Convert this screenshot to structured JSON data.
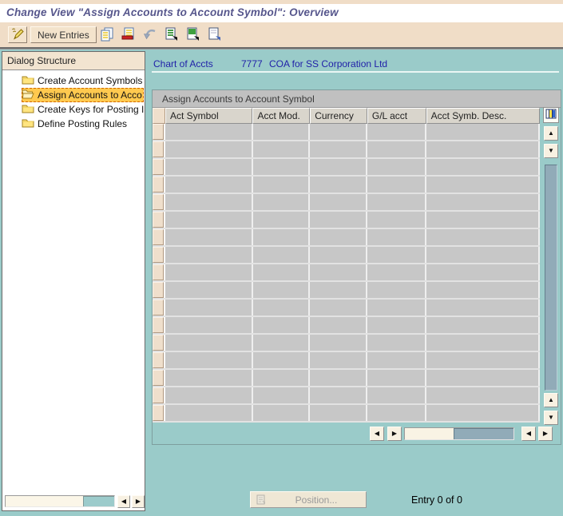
{
  "app": {
    "title": "Change View \"Assign Accounts to Account Symbol\": Overview"
  },
  "toolbar": {
    "new_entries_label": "New Entries",
    "icon_names": [
      "change-display-toggle",
      "copy-entry",
      "delete-entry",
      "undo-change",
      "select-all",
      "select-block",
      "deselect-all"
    ]
  },
  "dialog_structure": {
    "header": "Dialog Structure",
    "items": [
      {
        "label": "Create Account Symbols",
        "selected": false
      },
      {
        "label": "Assign Accounts to Acco",
        "selected": true
      },
      {
        "label": "Create Keys for Posting I",
        "selected": false
      },
      {
        "label": "Define Posting Rules",
        "selected": false
      }
    ]
  },
  "main": {
    "chart_of_accounts": {
      "label": "Chart of Accts",
      "value": "7777",
      "description": "COA for SS Corporation Ltd"
    },
    "table": {
      "caption": "Assign Accounts to Account Symbol",
      "columns": [
        "Act Symbol",
        "Acct Mod.",
        "Currency",
        "G/L acct",
        "Acct Symb. Desc."
      ],
      "row_count": 17
    },
    "position_button_label": "Position...",
    "entry_status": "Entry 0 of 0"
  },
  "colors": {
    "teal_background": "#9ACBC9",
    "toolbar_beige": "#F0DDC7",
    "selection_yellow": "#FFC94F",
    "selection_border_orange": "#D26900",
    "title_blue": "#56568C",
    "label_blue": "#1F1FA8",
    "table_cell_grey": "#C7C7C7",
    "row_selector_beige": "#EFDFCC",
    "scrollbar_thumb": "#91ABB8"
  }
}
